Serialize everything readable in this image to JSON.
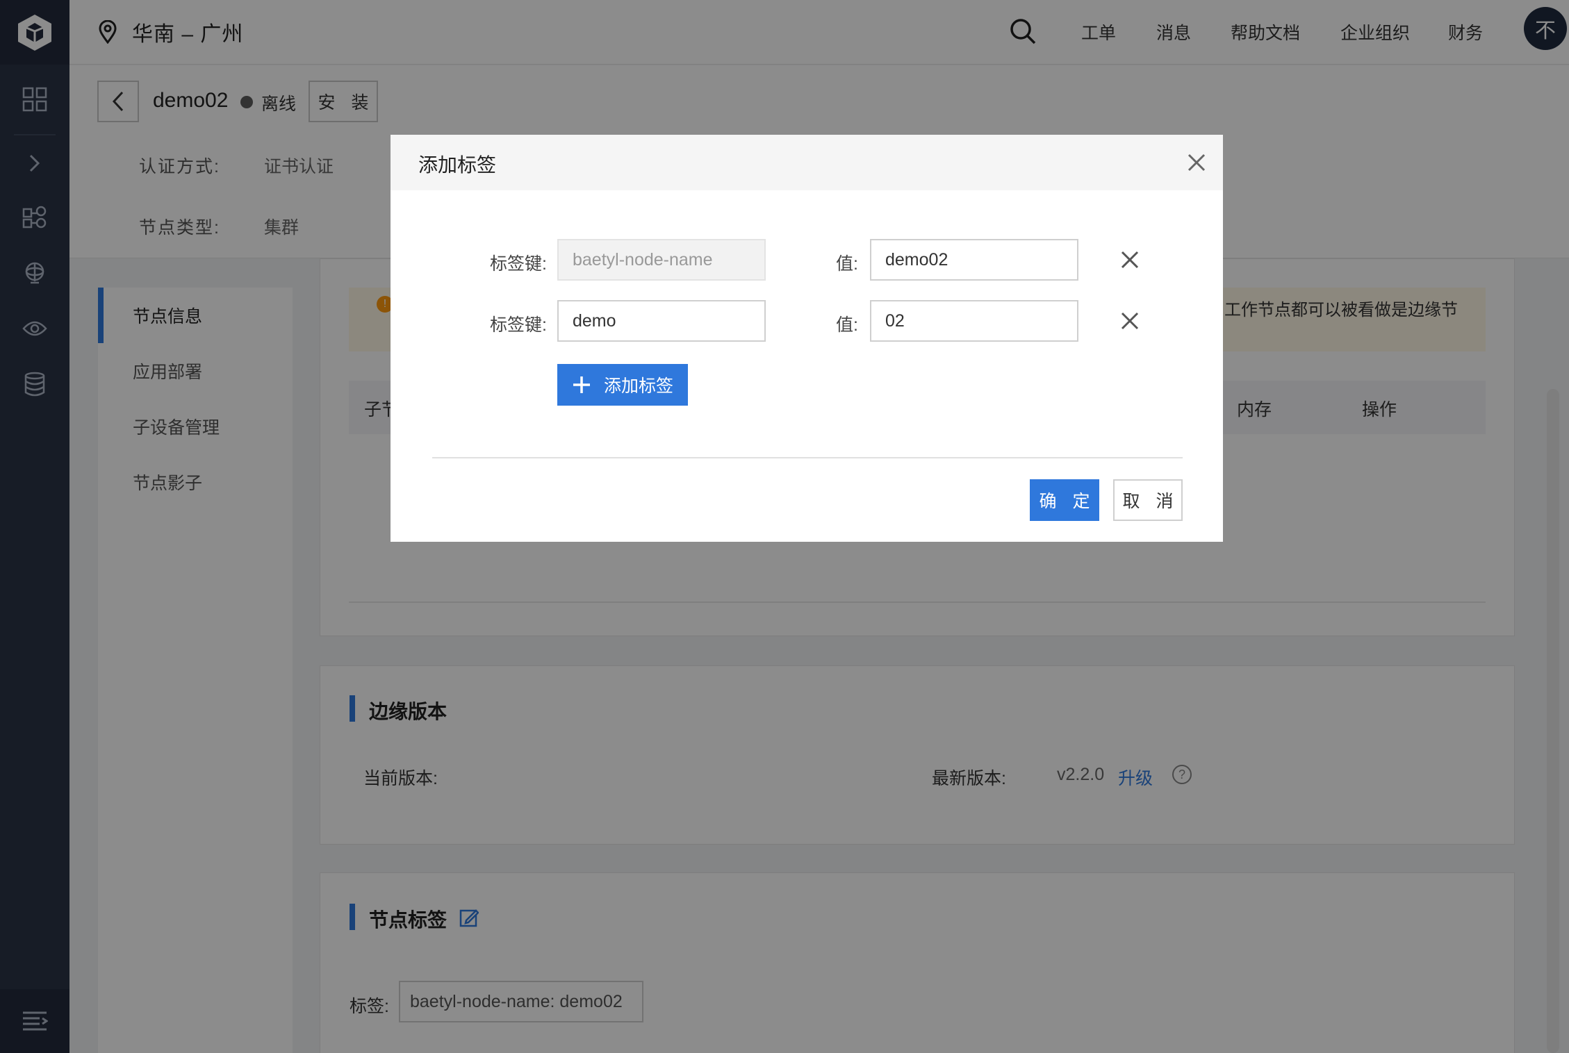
{
  "topbar": {
    "region": "华南 – 广州",
    "nav": [
      "工单",
      "消息",
      "帮助文档",
      "企业组织",
      "财务"
    ],
    "avatar": "不"
  },
  "sidebar": {
    "icons": [
      "logo-icon",
      "dashboard-icon",
      "expand-icon",
      "nodes-icon",
      "network-icon",
      "view-icon",
      "storage-icon",
      "menu-icon"
    ]
  },
  "header": {
    "node_name": "demo02",
    "status": "离线",
    "install_label": "安 装",
    "auth_label": "认证方式:",
    "auth_value": "证书认证",
    "type_label": "节点类型:",
    "type_value": "集群"
  },
  "subnav": {
    "items": [
      "节点信息",
      "应用部署",
      "子设备管理",
      "节点影子"
    ]
  },
  "content": {
    "warning_text": "工作节点都可以被看做是边缘节",
    "table_head": [
      "子节",
      "内存",
      "操作"
    ],
    "version": {
      "title": "边缘版本",
      "current_label": "当前版本:",
      "latest_label": "最新版本:",
      "latest_value": "v2.2.0",
      "upgrade_label": "升级"
    },
    "tags": {
      "title": "节点标签",
      "label": "标签:",
      "chip": "baetyl-node-name: demo02"
    }
  },
  "modal": {
    "title": "添加标签",
    "key_label": "标签键:",
    "value_label": "值:",
    "rows": [
      {
        "key": "baetyl-node-name",
        "value": "demo02",
        "key_disabled": true
      },
      {
        "key": "demo",
        "value": "02",
        "key_disabled": false
      }
    ],
    "add_label": "添加标签",
    "ok_label": "确 定",
    "cancel_label": "取 消"
  },
  "colors": {
    "primary": "#2f78dc",
    "sidebar": "#2a3346",
    "offline": "#5d5d5d"
  }
}
